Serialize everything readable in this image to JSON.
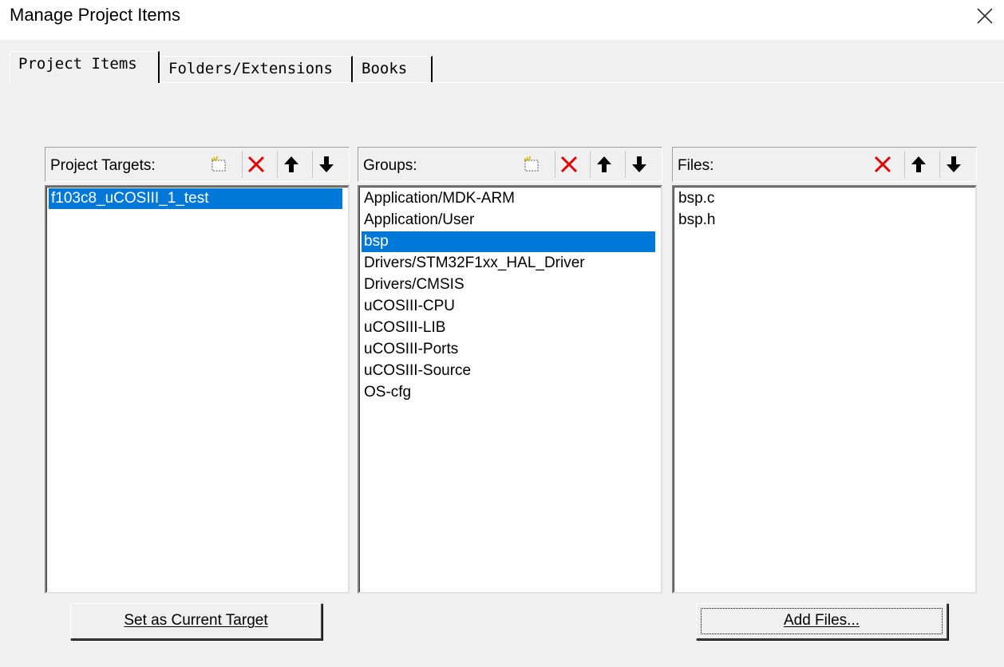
{
  "window": {
    "title": "Manage Project Items"
  },
  "tabs": [
    {
      "label": "Project Items",
      "active": true
    },
    {
      "label": "Folders/Extensions",
      "active": false
    },
    {
      "label": "Books",
      "active": false
    }
  ],
  "targets": {
    "label": "Project Targets:",
    "items": [
      "f103c8_uCOSIII_1_test"
    ],
    "selected_index": 0
  },
  "groups": {
    "label": "Groups:",
    "items": [
      "Application/MDK-ARM",
      "Application/User",
      "bsp",
      "Drivers/STM32F1xx_HAL_Driver",
      "Drivers/CMSIS",
      "uCOSIII-CPU",
      "uCOSIII-LIB",
      "uCOSIII-Ports",
      "uCOSIII-Source",
      "OS-cfg"
    ],
    "selected_index": 2
  },
  "files": {
    "label": "Files:",
    "items": [
      "bsp.c",
      "bsp.h"
    ]
  },
  "buttons": {
    "set_target": "Set as Current Target",
    "add_files": "Add Files..."
  },
  "colors": {
    "selection": "#0078d7",
    "delete_icon": "#e00000",
    "dialog_bg": "#f0f0f0"
  },
  "icons": [
    "close-icon",
    "new-item-icon",
    "delete-icon",
    "move-up-icon",
    "move-down-icon"
  ]
}
